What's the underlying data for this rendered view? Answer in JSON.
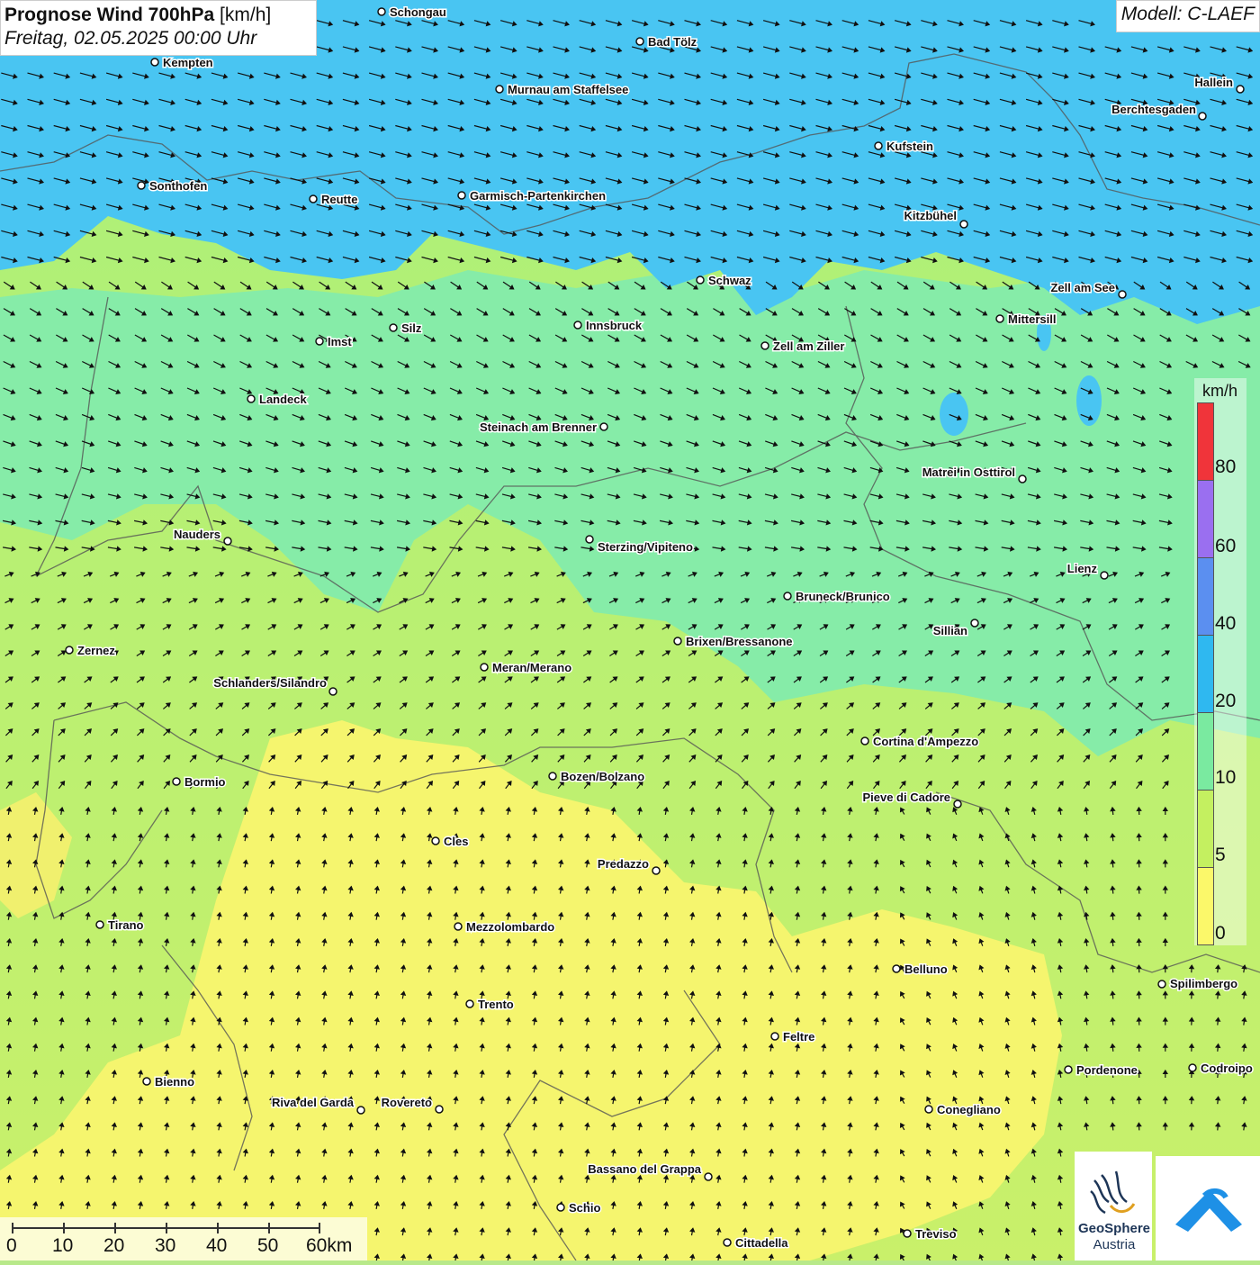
{
  "header": {
    "title_bold": "Prognose Wind 700hPa",
    "title_unit": "[km/h]",
    "datetime": "Freitag, 02.05.2025 00:00 Uhr"
  },
  "model": "Modell: C-LAEF",
  "legend": {
    "unit": "km/h",
    "labels": [
      "80",
      "60",
      "40",
      "20",
      "10",
      "5",
      "0"
    ],
    "colors": [
      "#f0343a",
      "#9a6ff0",
      "#5b8ff0",
      "#2fb8f0",
      "#7aeaa0",
      "#c4f060",
      "#fbf86a"
    ]
  },
  "scalebar": {
    "labels": [
      "0",
      "10",
      "20",
      "30",
      "40",
      "50",
      "60km"
    ]
  },
  "logo": {
    "name": "GeoSphere",
    "sub": "Austria"
  },
  "cities": [
    {
      "name": "Schongau"
    },
    {
      "name": "Bad Tölz"
    },
    {
      "name": "Kempten"
    },
    {
      "name": "Murnau am Staffelsee"
    },
    {
      "name": "Hallein"
    },
    {
      "name": "Berchtesgaden"
    },
    {
      "name": "Kufstein"
    },
    {
      "name": "Sonthofen"
    },
    {
      "name": "Reutte"
    },
    {
      "name": "Garmisch-Partenkirchen"
    },
    {
      "name": "Kitzbühel"
    },
    {
      "name": "Schwaz"
    },
    {
      "name": "Zell am See"
    },
    {
      "name": "Mittersill"
    },
    {
      "name": "Innsbruck"
    },
    {
      "name": "Silz"
    },
    {
      "name": "Imst"
    },
    {
      "name": "Zell am Ziller"
    },
    {
      "name": "Landeck"
    },
    {
      "name": "Steinach am Brenner"
    },
    {
      "name": "Matrei in Osttirol"
    },
    {
      "name": "Nauders"
    },
    {
      "name": "Sterzing/Vipiteno"
    },
    {
      "name": "Lienz"
    },
    {
      "name": "Bruneck/Brunico"
    },
    {
      "name": "Sillian"
    },
    {
      "name": "Zernez"
    },
    {
      "name": "Brixen/Bressanone"
    },
    {
      "name": "Meran/Merano"
    },
    {
      "name": "Schlanders/Silandro"
    },
    {
      "name": "Cortina d'Ampezzo"
    },
    {
      "name": "Bozen/Bolzano"
    },
    {
      "name": "Bormio"
    },
    {
      "name": "Pieve di Cadore"
    },
    {
      "name": "Cles"
    },
    {
      "name": "Predazzo"
    },
    {
      "name": "Tirano"
    },
    {
      "name": "Mezzolombardo"
    },
    {
      "name": "Belluno"
    },
    {
      "name": "Spilimbergo"
    },
    {
      "name": "Trento"
    },
    {
      "name": "Feltre"
    },
    {
      "name": "Pordenone"
    },
    {
      "name": "Codroipo"
    },
    {
      "name": "Bienno"
    },
    {
      "name": "Riva del Garda"
    },
    {
      "name": "Rovereto"
    },
    {
      "name": "Conegliano"
    },
    {
      "name": "Bassano del Grappa"
    },
    {
      "name": "Schio"
    },
    {
      "name": "Treviso"
    },
    {
      "name": "Cittadella"
    }
  ]
}
